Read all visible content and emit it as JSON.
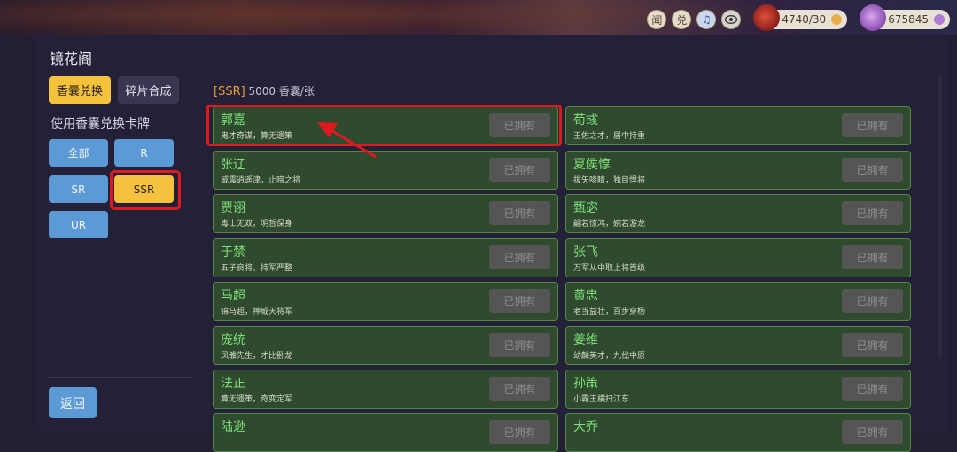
{
  "topbar": {
    "icon1": "闻",
    "icon2": "兑",
    "icon3": "♫",
    "icon4": "👁",
    "resource1": "4740/30",
    "resource2": "675845"
  },
  "sidebar": {
    "title": "镜花阁",
    "tabs": [
      "香囊兑换",
      "碎片合成"
    ],
    "section_label": "使用香囊兑换卡牌",
    "filters": [
      "全部",
      "R",
      "SR",
      "SSR",
      "UR"
    ],
    "selected_filter": "SSR",
    "back": "返回"
  },
  "price": {
    "tag": "[SSR]",
    "text": "5000 香囊/张"
  },
  "cards": [
    {
      "name": "郭嘉",
      "desc": "鬼才奇谋，算无遗策",
      "status": "已拥有"
    },
    {
      "name": "荀彧",
      "desc": "王佐之才，居中持重",
      "status": "已拥有"
    },
    {
      "name": "张辽",
      "desc": "威震逍遥津，止啼之将",
      "status": "已拥有"
    },
    {
      "name": "夏侯惇",
      "desc": "拔矢啖睛，独目悍将",
      "status": "已拥有"
    },
    {
      "name": "贾诩",
      "desc": "毒士无双，明哲保身",
      "status": "已拥有"
    },
    {
      "name": "甄宓",
      "desc": "翩若惊鸿，婉若游龙",
      "status": "已拥有"
    },
    {
      "name": "于禁",
      "desc": "五子良将，持军严整",
      "status": "已拥有"
    },
    {
      "name": "张飞",
      "desc": "万军从中取上将首级",
      "status": "已拥有"
    },
    {
      "name": "马超",
      "desc": "锦马超，神威天将军",
      "status": "已拥有"
    },
    {
      "name": "黄忠",
      "desc": "老当益壮，百步穿杨",
      "status": "已拥有"
    },
    {
      "name": "庞统",
      "desc": "凤雏先生，才比卧龙",
      "status": "已拥有"
    },
    {
      "name": "姜维",
      "desc": "幼麟英才，九伐中原",
      "status": "已拥有"
    },
    {
      "name": "法正",
      "desc": "算无遗策，奇变定军",
      "status": "已拥有"
    },
    {
      "name": "孙策",
      "desc": "小霸王横扫江东",
      "status": "已拥有"
    },
    {
      "name": "陆逊",
      "desc": "",
      "status": "已拥有"
    },
    {
      "name": "大乔",
      "desc": "",
      "status": "已拥有"
    }
  ],
  "colors": {
    "accent": "#f4c23c",
    "filter_button": "#5c9ad6",
    "card_bg": "#2f4a2e",
    "card_name": "#7ee07a",
    "highlight": "#e0191f"
  }
}
